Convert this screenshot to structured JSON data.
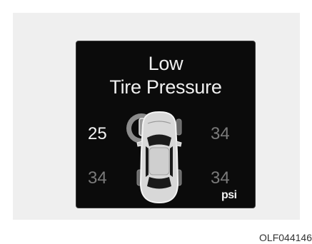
{
  "indicator": {
    "title_line1": "Low",
    "title_line2": "Tire Pressure",
    "unit": "psi",
    "alert_tire": "front-left",
    "pressures": {
      "front_left": "25",
      "front_right": "34",
      "rear_left": "34",
      "rear_right": "34"
    }
  },
  "colors": {
    "panel_bg": "#efefef",
    "display_bg": "#0b0b0b",
    "alert_value": "#f2f2f2",
    "normal_value": "#7a7a7a"
  },
  "figure_code": "OLF044146"
}
